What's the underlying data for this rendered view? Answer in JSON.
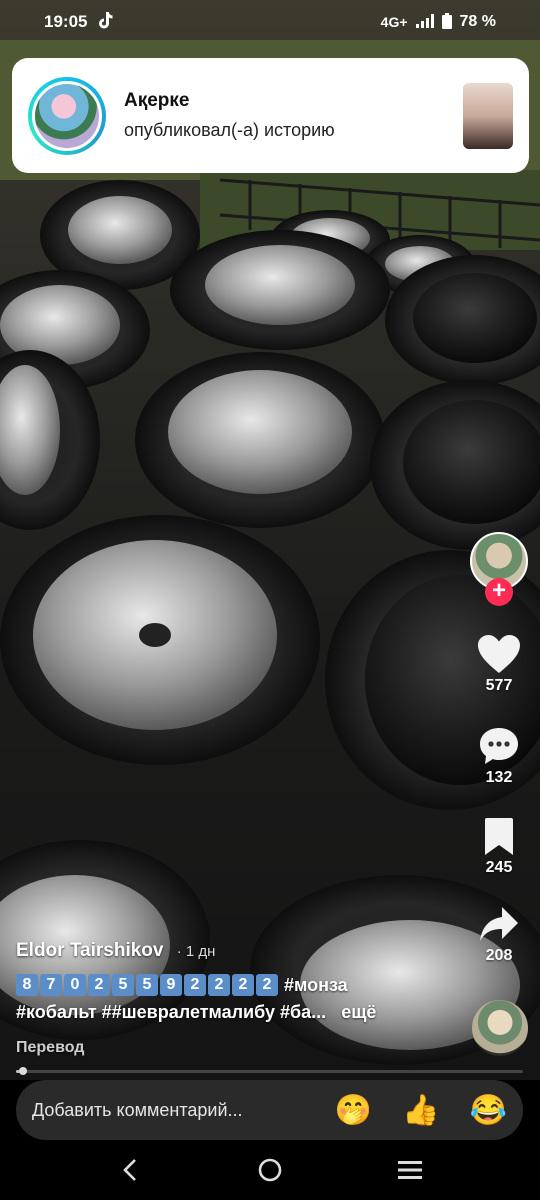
{
  "status_bar": {
    "time": "19:05",
    "network": "4G+",
    "battery": "78 %"
  },
  "notification": {
    "name": "Ақерке",
    "action": "опубликовал(-а) историю"
  },
  "actions": {
    "likes": "577",
    "comments": "132",
    "saves": "245",
    "shares": "208"
  },
  "caption": {
    "author": "Eldor Tairshikov",
    "age": "· 1 дн",
    "digits": [
      "8",
      "7",
      "0",
      "2",
      "5",
      "5",
      "9",
      "2",
      "2",
      "2",
      "2"
    ],
    "digits_tag": "#монза",
    "tags_line": "#кобальт ##шевралетмалибу #ба...",
    "more": "ещё",
    "translate": "Перевод"
  },
  "progress": 0.01,
  "comment_bar": {
    "placeholder": "Добавить комментарий...",
    "emojis": [
      "🤭",
      "👍",
      "😂"
    ]
  },
  "icons": {
    "tiktok": "tiktok-icon",
    "like": "heart-icon",
    "comment": "comment-icon",
    "save": "bookmark-icon",
    "share": "share-icon",
    "back": "back-icon",
    "home": "home-icon",
    "recents": "recents-icon"
  },
  "colors": {
    "accent": "#fe2c55",
    "digit_box": "#5b8ec9"
  }
}
